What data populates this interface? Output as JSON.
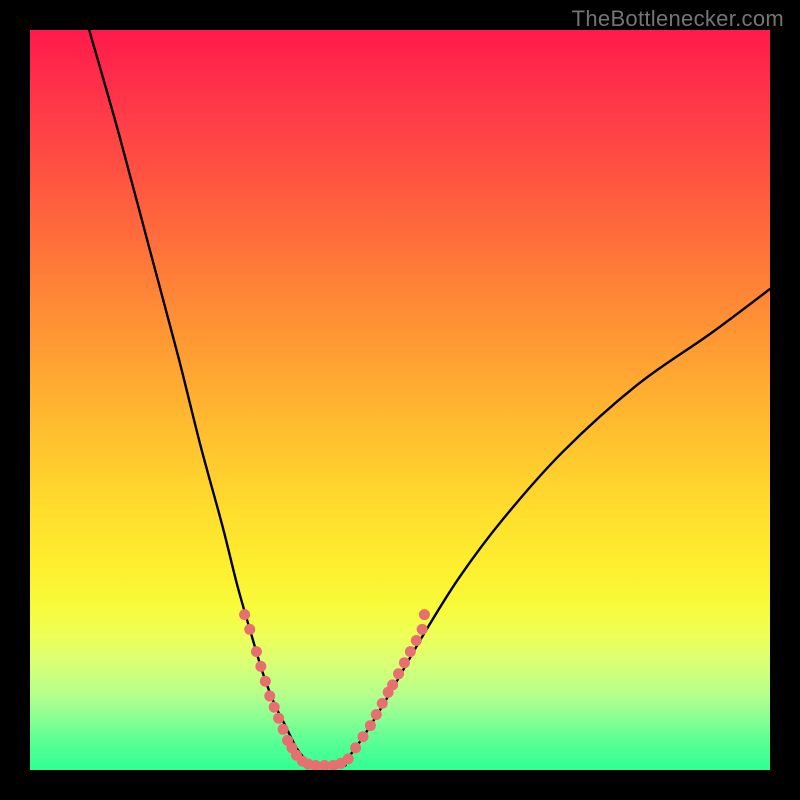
{
  "watermark": "TheBottlenecker.com",
  "colors": {
    "page_bg": "#000000",
    "curve": "#000000",
    "dots": "#e86f6f",
    "watermark": "#757575"
  },
  "chart_data": {
    "type": "line",
    "title": "",
    "xlabel": "",
    "ylabel": "",
    "xlim": [
      0,
      100
    ],
    "ylim": [
      0,
      100
    ],
    "series": [
      {
        "name": "left_branch",
        "x": [
          8,
          12,
          16,
          20,
          23,
          26,
          28,
          30,
          31.5,
          33,
          34.5,
          36,
          37.5
        ],
        "y": [
          100,
          86,
          71,
          56,
          44,
          33,
          25,
          18,
          13,
          9,
          6,
          3,
          1
        ]
      },
      {
        "name": "right_branch",
        "x": [
          42.5,
          44,
          46,
          49,
          53,
          58,
          64,
          72,
          82,
          92,
          100
        ],
        "y": [
          1,
          3,
          6,
          11,
          18,
          26,
          34,
          43,
          52,
          59,
          65
        ]
      }
    ],
    "valley_floor_x": [
      37.5,
      42.5
    ],
    "scatter": {
      "name": "sample_points",
      "points": [
        {
          "x": 29.0,
          "y": 21
        },
        {
          "x": 29.7,
          "y": 19
        },
        {
          "x": 30.6,
          "y": 16
        },
        {
          "x": 31.2,
          "y": 14
        },
        {
          "x": 31.8,
          "y": 12
        },
        {
          "x": 32.4,
          "y": 10
        },
        {
          "x": 33.0,
          "y": 8.5
        },
        {
          "x": 33.6,
          "y": 7
        },
        {
          "x": 34.2,
          "y": 5.5
        },
        {
          "x": 34.8,
          "y": 4
        },
        {
          "x": 35.4,
          "y": 3
        },
        {
          "x": 36.0,
          "y": 2
        },
        {
          "x": 36.8,
          "y": 1.2
        },
        {
          "x": 37.6,
          "y": 0.8
        },
        {
          "x": 38.6,
          "y": 0.6
        },
        {
          "x": 39.8,
          "y": 0.6
        },
        {
          "x": 41.0,
          "y": 0.6
        },
        {
          "x": 42.0,
          "y": 0.9
        },
        {
          "x": 43.0,
          "y": 1.5
        },
        {
          "x": 44.0,
          "y": 3
        },
        {
          "x": 45.0,
          "y": 4.5
        },
        {
          "x": 46.0,
          "y": 6
        },
        {
          "x": 46.8,
          "y": 7.5
        },
        {
          "x": 47.6,
          "y": 9
        },
        {
          "x": 48.4,
          "y": 10.5
        },
        {
          "x": 49.0,
          "y": 11.5
        },
        {
          "x": 49.8,
          "y": 13
        },
        {
          "x": 50.6,
          "y": 14.5
        },
        {
          "x": 51.4,
          "y": 16
        },
        {
          "x": 52.2,
          "y": 17.5
        },
        {
          "x": 53.0,
          "y": 19
        },
        {
          "x": 53.3,
          "y": 21
        }
      ]
    },
    "gradient_stops": [
      {
        "pos": 0,
        "color": "#ff1a4b"
      },
      {
        "pos": 50,
        "color": "#ffc72e"
      },
      {
        "pos": 80,
        "color": "#f7fb3a"
      },
      {
        "pos": 100,
        "color": "#2fff93"
      }
    ]
  }
}
